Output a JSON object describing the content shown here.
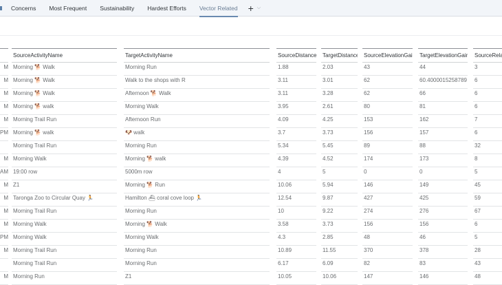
{
  "tabs": [
    {
      "label": "Concerns"
    },
    {
      "label": "Most Frequent"
    },
    {
      "label": "Sustainability"
    },
    {
      "label": "Hardest Efforts"
    },
    {
      "label": "Vector Related",
      "active": true
    }
  ],
  "add_tab_icon": "plus-icon",
  "columns": [
    "",
    "SourceActivityName",
    "TargetActivityName",
    "SourceDistance",
    "TargetDistance",
    "SourceElevationGain",
    "TargetElevationGain",
    "SourceRela"
  ],
  "rows": [
    [
      "M",
      "Morning 🐕 Walk",
      "Morning Run",
      "1.88",
      "2.03",
      "43",
      "44",
      "3"
    ],
    [
      "M",
      "Morning 🐕 Walk",
      "Walk to the shops with R",
      "3.11",
      "3.01",
      "62",
      "60.4000015258789",
      "6"
    ],
    [
      "M",
      "Morning 🐕 Walk",
      "Afternoon 🐕 Walk",
      "3.11",
      "3.28",
      "62",
      "66",
      "6"
    ],
    [
      "M",
      "Morning 🐕 walk",
      "Morning Walk",
      "3.95",
      "2.61",
      "80",
      "81",
      "6"
    ],
    [
      "M",
      "Morning Trail Run",
      "Afternoon Run",
      "4.09",
      "4.25",
      "153",
      "162",
      "7"
    ],
    [
      "PM",
      "Morning 🐕 walk",
      "🐶 walk",
      "3.7",
      "3.73",
      "156",
      "157",
      "6"
    ],
    [
      "",
      "Morning Trail Run",
      "Morning Run",
      "5.34",
      "5.45",
      "89",
      "88",
      "32"
    ],
    [
      "M",
      "Morning Walk",
      "Morning 🐕 walk",
      "4.39",
      "4.52",
      "174",
      "173",
      "8"
    ],
    [
      "AM",
      "19:00 row",
      "5000m row",
      "4",
      "5",
      "0",
      "0",
      "5"
    ],
    [
      "M",
      "Z1",
      "Morning 🐕 Run",
      "10.06",
      "5.94",
      "146",
      "149",
      "45"
    ],
    [
      "M",
      "Taronga Zoo to Circular Quay 🏃",
      "Hamilton ⛴ coral cove loop 🏃",
      "12.54",
      "9.87",
      "427",
      "425",
      "59"
    ],
    [
      "M",
      "Morning Trail Run",
      "Morning Run",
      "10",
      "9.22",
      "274",
      "276",
      "67"
    ],
    [
      "M",
      "Morning Walk",
      "Morning 🐕 Walk",
      "3.58",
      "3.73",
      "156",
      "156",
      "6"
    ],
    [
      "PM",
      "Morning Walk",
      "Morning Walk",
      "4.3",
      "2.85",
      "48",
      "46",
      "5"
    ],
    [
      "M",
      "Morning Trail Run",
      "Morning Run",
      "10.89",
      "11.55",
      "370",
      "378",
      "28"
    ],
    [
      "",
      "Morning Trail Run",
      "Morning Run",
      "6.17",
      "6.09",
      "82",
      "83",
      "43"
    ],
    [
      "M",
      "Morning Run",
      "Z1",
      "10.05",
      "10.06",
      "147",
      "146",
      "48"
    ]
  ]
}
